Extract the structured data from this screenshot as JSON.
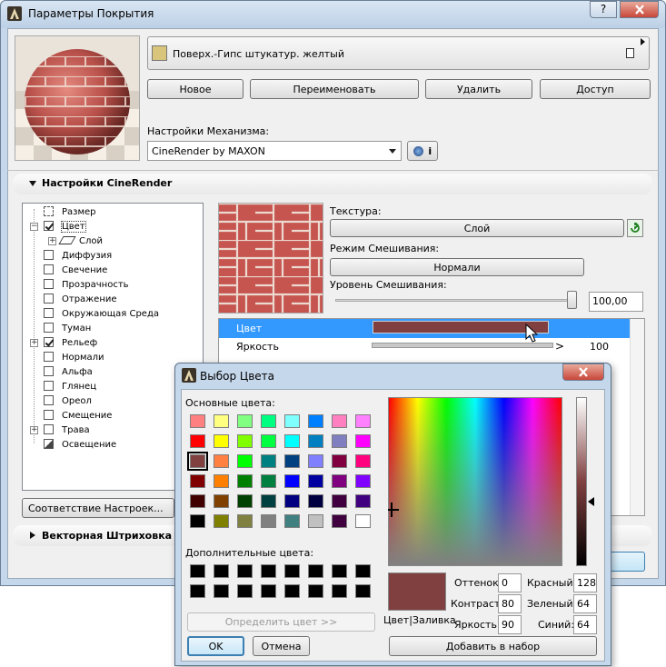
{
  "main_window": {
    "title": "Параметры Покрытия",
    "help_label": "?",
    "material_name": "Поверх.-Гипс штукатур. желтый",
    "buttons": {
      "new": "Новое",
      "rename": "Переименовать",
      "delete": "Удалить",
      "access": "Доступ"
    },
    "engine_label": "Настройки Механизма:",
    "engine_value": "CineRender by MAXON",
    "info_label": "i",
    "section_cinerender": "Настройки CineRender",
    "section_vector": "Векторная Штриховка",
    "tree": [
      {
        "label": "Размер",
        "checked": false
      },
      {
        "label": "Цвет",
        "checked": true
      },
      {
        "label": "Слой",
        "checked": false
      },
      {
        "label": "Диффузия",
        "checked": false
      },
      {
        "label": "Свечение",
        "checked": false
      },
      {
        "label": "Прозрачность",
        "checked": false
      },
      {
        "label": "Отражение",
        "checked": false
      },
      {
        "label": "Окружающая Среда",
        "checked": false
      },
      {
        "label": "Туман",
        "checked": false
      },
      {
        "label": "Рельеф",
        "checked": true
      },
      {
        "label": "Нормали",
        "checked": false
      },
      {
        "label": "Альфа",
        "checked": false
      },
      {
        "label": "Глянец",
        "checked": false
      },
      {
        "label": "Ореол",
        "checked": false
      },
      {
        "label": "Смещение",
        "checked": false
      },
      {
        "label": "Трава",
        "checked": false
      },
      {
        "label": "Освещение",
        "checked": false
      }
    ],
    "match_settings_button": "Соответствие Настроек...",
    "texture_label": "Текстура:",
    "texture_button": "Слой",
    "blend_mode_label": "Режим Смешивания:",
    "blend_mode_button": "Нормали",
    "blend_level_label": "Уровень Смешивания:",
    "blend_level_value": "100,00",
    "prop_rows": [
      {
        "label": "Цвет",
        "value": ""
      },
      {
        "label": "Яркость",
        "value": "100"
      }
    ]
  },
  "color_dialog": {
    "title": "Выбор Цвета",
    "basic_colors_label": "Основные цвета:",
    "basic_colors": [
      "#ff8080",
      "#ffff80",
      "#80ff80",
      "#00ff80",
      "#80ffff",
      "#0080ff",
      "#ff80c0",
      "#ff80ff",
      "#ff0000",
      "#ffff00",
      "#80ff00",
      "#00ff40",
      "#00ffff",
      "#0080c0",
      "#8080c0",
      "#ff00ff",
      "#804040",
      "#ff8040",
      "#00ff00",
      "#008080",
      "#004080",
      "#8080ff",
      "#800040",
      "#ff0080",
      "#800000",
      "#ff8000",
      "#008000",
      "#008040",
      "#0000ff",
      "#0000a0",
      "#800080",
      "#8000ff",
      "#400000",
      "#804000",
      "#004000",
      "#004040",
      "#000080",
      "#000040",
      "#400040",
      "#400080",
      "#000000",
      "#808000",
      "#808040",
      "#808080",
      "#408080",
      "#c0c0c0",
      "#400040",
      "#ffffff"
    ],
    "custom_colors_label": "Дополнительные цвета:",
    "define_button": "Определить цвет >>",
    "ok_button": "OK",
    "cancel_button": "Отмена",
    "preview_label": "Цвет|Заливка",
    "selected_color": "#804040",
    "fields": {
      "hue_label": "Оттенок:",
      "hue": "0",
      "sat_label": "Контраст:",
      "sat": "80",
      "lum_label": "Яркость:",
      "lum": "90",
      "red_label": "Красный:",
      "red": "128",
      "green_label": "Зеленый:",
      "green": "64",
      "blue_label": "Синий:",
      "blue": "64"
    },
    "add_button": "Добавить в набор"
  },
  "colors": {
    "accent": "#3399ff",
    "material_swatch": "#d8c47a",
    "brick": "#b8504a",
    "selected": "#804040"
  }
}
